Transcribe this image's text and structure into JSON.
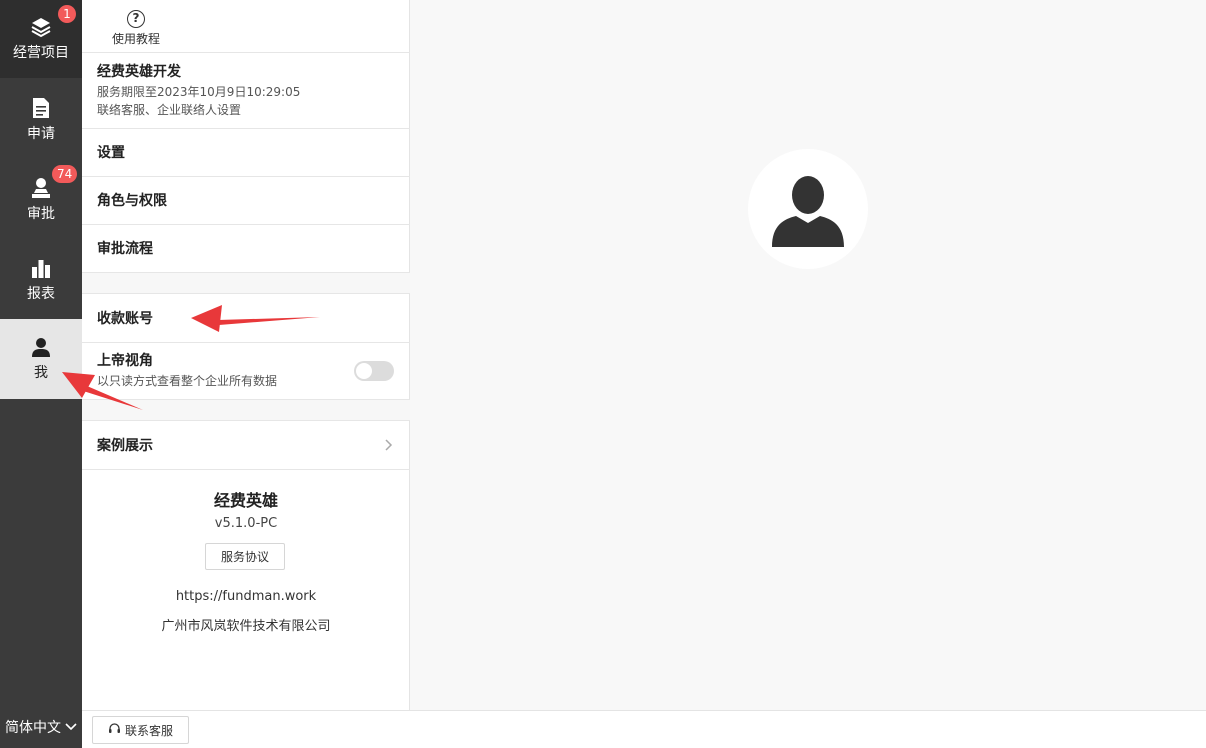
{
  "rail": {
    "items": [
      {
        "label": "经营项目",
        "icon": "layers-icon",
        "badge": "1"
      },
      {
        "label": "申请",
        "icon": "document-icon",
        "badge": ""
      },
      {
        "label": "审批",
        "icon": "approval-stamp-icon",
        "badge": "74"
      },
      {
        "label": "报表",
        "icon": "bar-chart-icon",
        "badge": ""
      },
      {
        "label": "我",
        "icon": "user-icon",
        "badge": ""
      }
    ],
    "language": "简体中文"
  },
  "panel": {
    "help_label": "使用教程",
    "company": {
      "name": "经费英雄开发",
      "expiry": "服务期限至2023年10月9日10:29:05",
      "settings_hint": "联络客服、企业联络人设置"
    },
    "settings": "设置",
    "roles": "角色与权限",
    "workflow": "审批流程",
    "payee_account": "收款账号",
    "god_view": {
      "title": "上帝视角",
      "desc": "以只读方式查看整个企业所有数据"
    },
    "case_showcase": "案例展示",
    "about": {
      "app_name": "经费英雄",
      "version": "v5.1.0-PC",
      "agreement_button": "服务协议",
      "url": "https://fundman.work",
      "company": "广州市风岚软件技术有限公司"
    }
  },
  "bottom": {
    "contact_service": "联系客服"
  },
  "colors": {
    "rail_bg": "#3b3b3b",
    "badge": "#f25a5a",
    "arrow": "#e8383a"
  }
}
